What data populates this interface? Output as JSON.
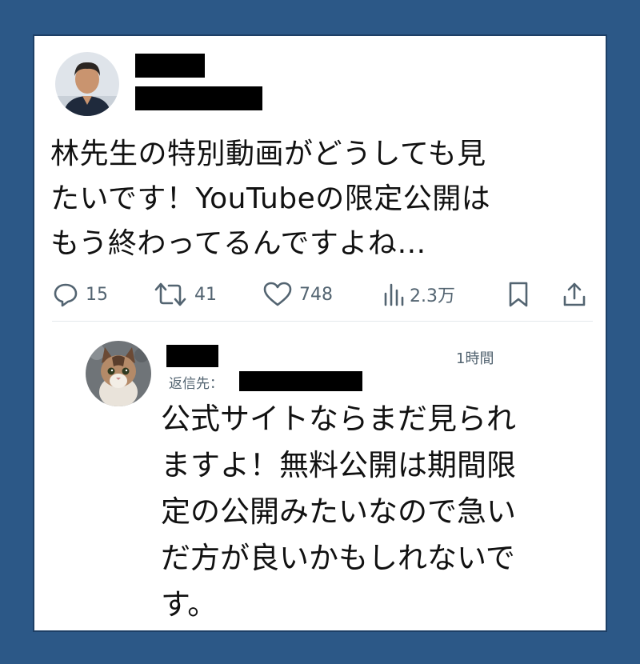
{
  "tweet": {
    "text_lines": [
      "林先生の特別動画がどうしても見",
      "たいです！YouTubeの限定公開は",
      "もう終わってるんですよね…"
    ],
    "actions": {
      "reply_count": "15",
      "retweet_count": "41",
      "like_count": "748",
      "views_count": "2.3万"
    }
  },
  "reply": {
    "time": "1時間",
    "reply_to_label": "返信先：",
    "text_lines": [
      "公式サイトならまだ見られ",
      "ますよ！無料公開は期間限",
      "定の公開みたいなので急い",
      "だ方が良いかもしれないで",
      "す。"
    ]
  },
  "colors": {
    "background": "#2c5887",
    "card": "#ffffff",
    "icon_gray": "#536471"
  },
  "icons": [
    "reply-icon",
    "retweet-icon",
    "like-icon",
    "views-icon",
    "bookmark-icon",
    "share-icon"
  ]
}
